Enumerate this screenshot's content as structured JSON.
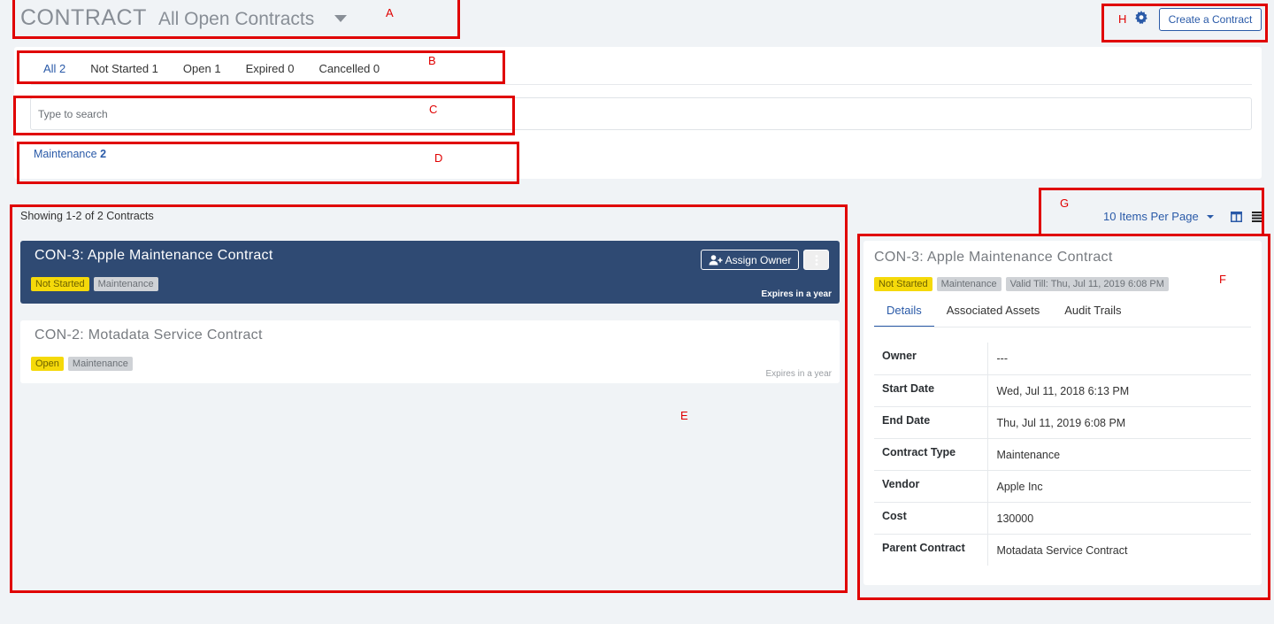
{
  "header": {
    "title": "CONTRACT",
    "view_name": "All Open Contracts",
    "create_button": "Create a Contract"
  },
  "tabs": [
    {
      "label": "All 2",
      "active": true
    },
    {
      "label": "Not Started 1",
      "active": false
    },
    {
      "label": "Open 1",
      "active": false
    },
    {
      "label": "Expired 0",
      "active": false
    },
    {
      "label": "Cancelled 0",
      "active": false
    }
  ],
  "search": {
    "placeholder": "Type to search",
    "value": ""
  },
  "chips": [
    {
      "label": "Maintenance",
      "count": "2"
    }
  ],
  "listing": {
    "showing_text": "Showing 1-2 of 2 Contracts",
    "per_page": "10 Items Per Page",
    "assign_owner_label": "Assign Owner",
    "cards": [
      {
        "title": "CON-3: Apple Maintenance Contract",
        "status": "Not Started",
        "type": "Maintenance",
        "expires": "Expires in a year",
        "selected": true
      },
      {
        "title": "CON-2: Motadata Service Contract",
        "status": "Open",
        "type": "Maintenance",
        "expires": "Expires in a year",
        "selected": false
      }
    ]
  },
  "detail": {
    "title": "CON-3: Apple Maintenance Contract",
    "tags": {
      "status": "Not Started",
      "type": "Maintenance",
      "valid_till": "Valid Till: Thu, Jul 11, 2019 6:08 PM"
    },
    "tabs": [
      "Details",
      "Associated Assets",
      "Audit Trails"
    ],
    "fields": [
      {
        "label": "Owner",
        "value": "---"
      },
      {
        "label": "Start Date",
        "value": "Wed, Jul 11, 2018 6:13 PM"
      },
      {
        "label": "End Date",
        "value": "Thu, Jul 11, 2019 6:08 PM"
      },
      {
        "label": "Contract Type",
        "value": "Maintenance"
      },
      {
        "label": "Vendor",
        "value": "Apple Inc"
      },
      {
        "label": "Cost",
        "value": "130000"
      },
      {
        "label": "Parent Contract",
        "value": "Motadata Service Contract"
      }
    ]
  },
  "annotations": {
    "A": "A",
    "B": "B",
    "C": "C",
    "D": "D",
    "E": "E",
    "F": "F",
    "G": "G",
    "H": "H"
  },
  "colors": {
    "accent": "#2a5aa8",
    "selected_card": "#2f4a73",
    "annotation": "#e00000",
    "tag_yellow": "#f5d90a",
    "tag_gray": "#cfd2d6"
  },
  "icons": [
    "gear-icon",
    "caret-down-icon",
    "user-plus-icon",
    "kebab-icon",
    "split-view-icon",
    "list-view-icon"
  ]
}
